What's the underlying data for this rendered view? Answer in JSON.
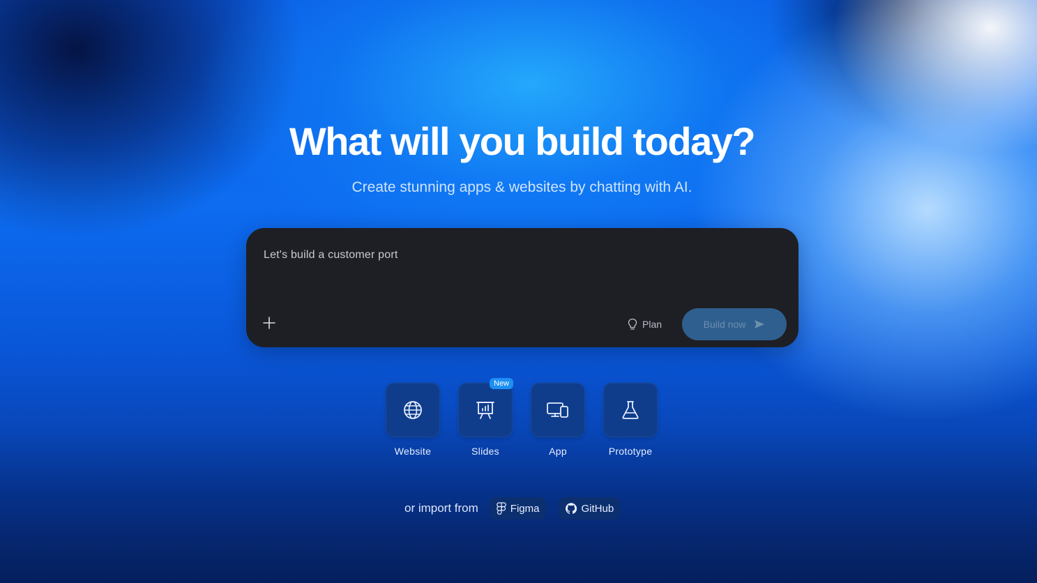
{
  "hero": {
    "title": "What will you build today?",
    "subtitle": "Create stunning apps & websites by chatting with AI."
  },
  "prompt": {
    "value": "Let's build a customer port",
    "add_icon": "plus-icon",
    "plan_label": "Plan",
    "plan_icon": "lightbulb-icon",
    "build_label": "Build now",
    "build_icon": "send-arrow-icon"
  },
  "templates": {
    "items": [
      {
        "label": "Website",
        "icon": "globe-icon"
      },
      {
        "label": "Slides",
        "icon": "presentation-chart-icon",
        "badge": "New"
      },
      {
        "label": "App",
        "icon": "devices-icon"
      },
      {
        "label": "Prototype",
        "icon": "flask-icon"
      }
    ]
  },
  "import": {
    "label": "or import from",
    "figma_label": "Figma",
    "github_label": "GitHub"
  },
  "colors": {
    "prompt_bg": "#1e1f24",
    "build_button_bg": "#2e5f8f",
    "tile_bg": "#0f3d8c",
    "badge_bg": "#1e8ff5"
  }
}
